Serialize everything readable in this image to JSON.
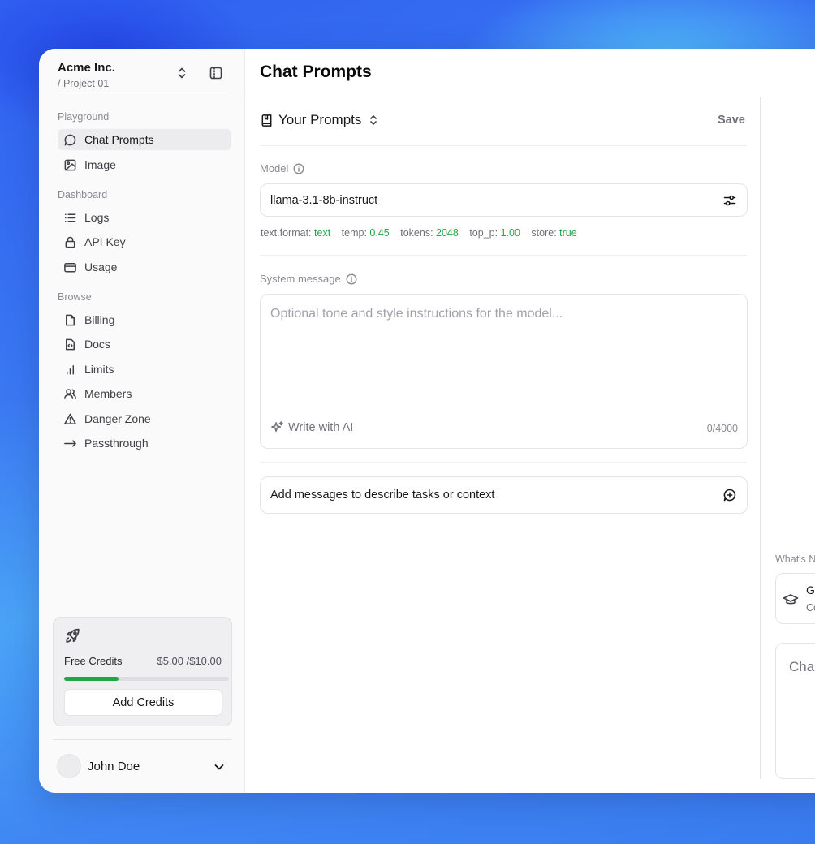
{
  "workspace": {
    "name": "Acme Inc.",
    "project": "/ Project 01"
  },
  "sidebar": {
    "sections": [
      {
        "title": "Playground",
        "items": [
          {
            "label": "Chat Prompts",
            "icon": "chat-bubble-icon",
            "active": true
          },
          {
            "label": "Image",
            "icon": "image-icon"
          }
        ]
      },
      {
        "title": "Dashboard",
        "items": [
          {
            "label": "Logs",
            "icon": "list-icon"
          },
          {
            "label": "API Key",
            "icon": "lock-icon"
          },
          {
            "label": "Usage",
            "icon": "credit-card-icon"
          }
        ]
      },
      {
        "title": "Browse",
        "items": [
          {
            "label": "Billing",
            "icon": "file-icon"
          },
          {
            "label": "Docs",
            "icon": "file-code-icon"
          },
          {
            "label": "Limits",
            "icon": "bar-chart-icon"
          },
          {
            "label": "Members",
            "icon": "users-icon"
          },
          {
            "label": "Danger Zone",
            "icon": "warning-icon"
          },
          {
            "label": "Passthrough",
            "icon": "arrow-right-icon"
          }
        ]
      }
    ]
  },
  "credits": {
    "label": "Free Credits",
    "amount": "$5.00 /$10.00",
    "progress": 0.33,
    "button": "Add Credits",
    "accent": "#22a447"
  },
  "user": {
    "name": "John Doe"
  },
  "main": {
    "title": "Chat Prompts",
    "prompts_title": "Your Prompts",
    "save_label": "Save",
    "model": {
      "label": "Model",
      "value": "llama-3.1-8b-instruct",
      "params": [
        {
          "key": "text.format:",
          "value": "text"
        },
        {
          "key": "temp:",
          "value": "0.45"
        },
        {
          "key": "tokens:",
          "value": "2048"
        },
        {
          "key": "top_p:",
          "value": "1.00"
        },
        {
          "key": "store:",
          "value": "true"
        }
      ]
    },
    "system_message": {
      "label": "System message",
      "placeholder": "Optional tone and style instructions for the model...",
      "write_ai": "Write with AI",
      "count": "0/4000"
    },
    "add_messages": "Add messages to describe tasks or context"
  },
  "right_panel": {
    "whats_new": "What's N",
    "card": {
      "title": "G",
      "subtitle": "Co"
    },
    "chat_placeholder": "Cha"
  },
  "colors": {
    "accent_green": "#22a447",
    "background": "#3a78f2"
  }
}
